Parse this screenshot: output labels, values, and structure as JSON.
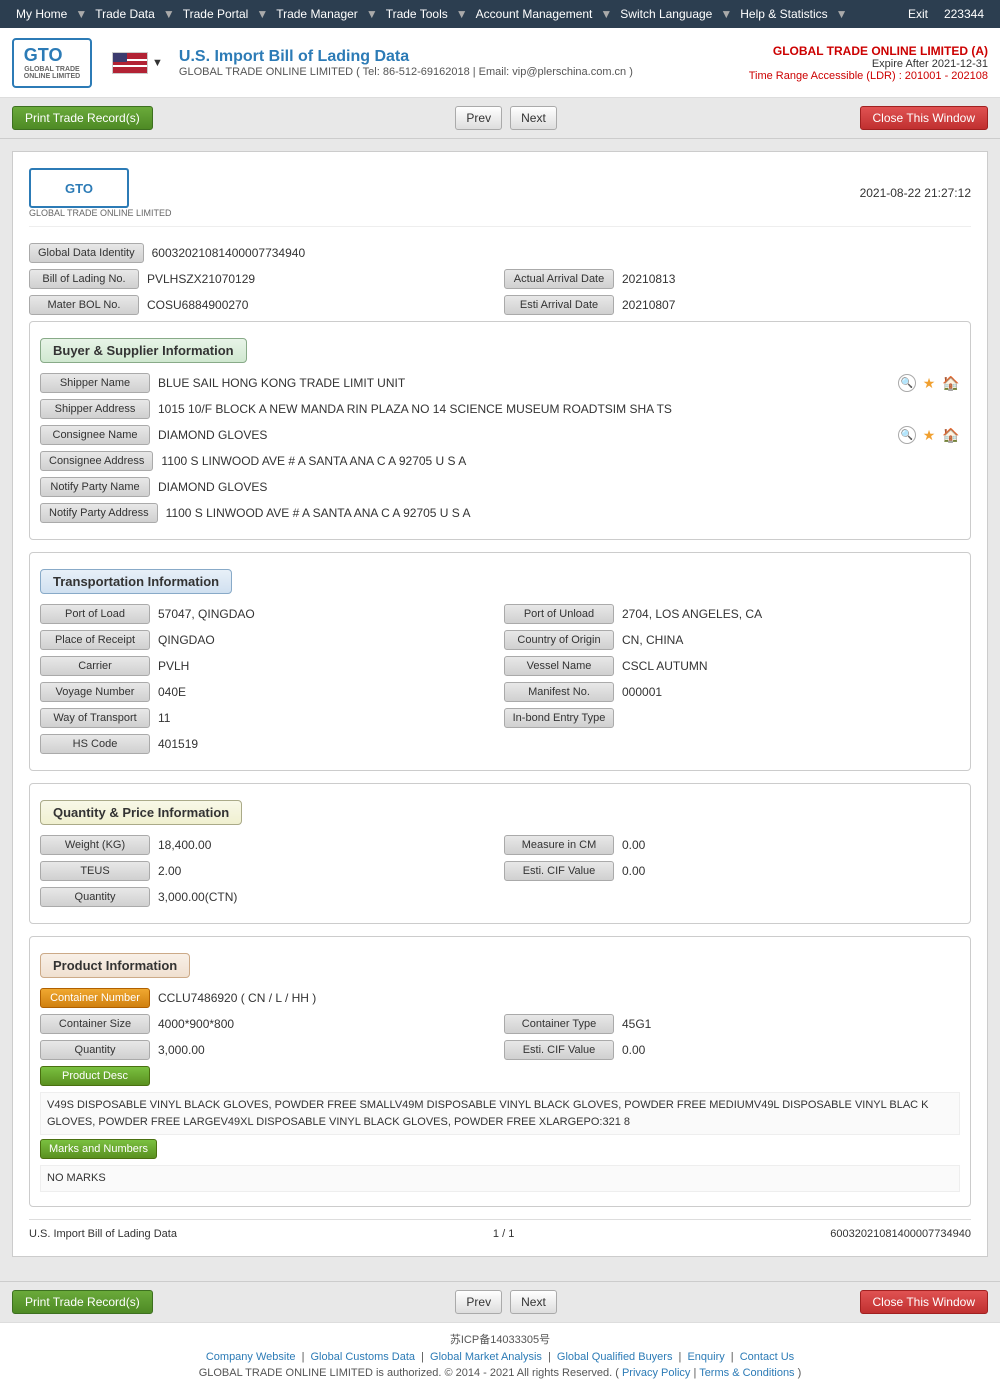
{
  "nav": {
    "items": [
      "My Home",
      "Trade Data",
      "Trade Portal",
      "Trade Manager",
      "Trade Tools",
      "Account Management",
      "Switch Language",
      "Help & Statistics",
      "Exit"
    ],
    "user_id": "223344"
  },
  "header": {
    "logo_text": "GTO",
    "logo_sub": "GLOBAL TRADE ONLINE LIMITED",
    "flag_label": "US Flag",
    "title": "U.S. Import Bill of Lading Data",
    "subtitle": "GLOBAL TRADE ONLINE LIMITED ( Tel: 86-512-69162018 | Email: vip@plerschina.com.cn )",
    "account": {
      "company": "GLOBAL TRADE ONLINE LIMITED (A)",
      "expire": "Expire After 2021-12-31",
      "range": "Time Range Accessible (LDR) : 201001 - 202108"
    }
  },
  "toolbar": {
    "print_label": "Print Trade Record(s)",
    "prev_label": "Prev",
    "next_label": "Next",
    "close_label": "Close This Window"
  },
  "record": {
    "datetime": "2021-08-22 21:27:12",
    "global_data_identity": "60032021081400007734940",
    "bill_of_lading_no": "PVLHSZX21070129",
    "actual_arrival_date": "20210813",
    "mater_bol_no": "COSU6884900270",
    "esti_arrival_date": "20210807",
    "buyer_supplier": {
      "header": "Buyer & Supplier Information",
      "shipper_name": "BLUE SAIL HONG KONG TRADE LIMIT UNIT",
      "shipper_address": "1015 10/F BLOCK A NEW MANDA RIN PLAZA NO 14 SCIENCE MUSEUM ROADTSIM SHA TS",
      "consignee_name": "DIAMOND GLOVES",
      "consignee_address": "1100 S LINWOOD AVE # A SANTA ANA C A 92705 U S A",
      "notify_party_name": "DIAMOND GLOVES",
      "notify_party_address": "1100 S LINWOOD AVE # A SANTA ANA C A 92705 U S A"
    },
    "transportation": {
      "header": "Transportation Information",
      "port_of_load": "57047, QINGDAO",
      "port_of_unload": "2704, LOS ANGELES, CA",
      "place_of_receipt": "QINGDAO",
      "country_of_origin": "CN, CHINA",
      "carrier": "PVLH",
      "vessel_name": "CSCL AUTUMN",
      "voyage_number": "040E",
      "manifest_no": "000001",
      "way_of_transport": "11",
      "in_bond_entry_type": "",
      "hs_code": "401519"
    },
    "quantity_price": {
      "header": "Quantity & Price Information",
      "weight_kg": "18,400.00",
      "measure_in_cm": "0.00",
      "teus": "2.00",
      "esti_cif_value": "0.00",
      "quantity": "3,000.00(CTN)"
    },
    "product": {
      "header": "Product Information",
      "container_number": "CCLU7486920 ( CN / L / HH )",
      "container_size": "4000*900*800",
      "container_type": "45G1",
      "quantity": "3,000.00",
      "esti_cif_value": "0.00",
      "product_desc": "V49S DISPOSABLE VINYL BLACK GLOVES, POWDER FREE SMALLV49M DISPOSABLE VINYL BLACK GLOVES, POWDER FREE MEDIUMV49L DISPOSABLE VINYL BLAC K GLOVES, POWDER FREE LARGEV49XL DISPOSABLE VINYL BLACK GLOVES, POWDER FREE XLARGEPO:321 8",
      "marks_and_numbers": "NO MARKS"
    },
    "footer": {
      "page_title": "U.S. Import Bill of Lading Data",
      "page_number": "1 / 1",
      "record_id": "60032021081400007734940"
    }
  },
  "bottom_toolbar": {
    "print_label": "Print Trade Record(s)",
    "prev_label": "Prev",
    "next_label": "Next",
    "close_label": "Close This Window"
  },
  "footer": {
    "icp": "苏ICP备14033305号",
    "links": [
      "Company Website",
      "Global Customs Data",
      "Global Market Analysis",
      "Global Qualified Buyers",
      "Enquiry",
      "Contact Us"
    ],
    "copyright": "GLOBAL TRADE ONLINE LIMITED is authorized. © 2014 - 2021 All rights Reserved.",
    "privacy": "Privacy Policy",
    "terms": "Terms & Conditions"
  },
  "labels": {
    "global_data_identity": "Global Data Identity",
    "bill_of_lading_no": "Bill of Lading No.",
    "actual_arrival_date": "Actual Arrival Date",
    "mater_bol_no": "Mater BOL No.",
    "esti_arrival_date": "Esti Arrival Date",
    "shipper_name": "Shipper Name",
    "shipper_address": "Shipper Address",
    "consignee_name": "Consignee Name",
    "consignee_address": "Consignee Address",
    "notify_party_name": "Notify Party Name",
    "notify_party_address": "Notify Party Address",
    "port_of_load": "Port of Load",
    "port_of_unload": "Port of Unload",
    "place_of_receipt": "Place of Receipt",
    "country_of_origin": "Country of Origin",
    "carrier": "Carrier",
    "vessel_name": "Vessel Name",
    "voyage_number": "Voyage Number",
    "manifest_no": "Manifest No.",
    "way_of_transport": "Way of Transport",
    "in_bond_entry_type": "In-bond Entry Type",
    "hs_code": "HS Code",
    "weight_kg": "Weight (KG)",
    "measure_in_cm": "Measure in CM",
    "teus": "TEUS",
    "esti_cif_value": "Esti. CIF Value",
    "quantity": "Quantity",
    "container_number": "Container Number",
    "container_size": "Container Size",
    "container_type": "Container Type",
    "product_desc": "Product Desc",
    "marks_and_numbers": "Marks and Numbers"
  }
}
